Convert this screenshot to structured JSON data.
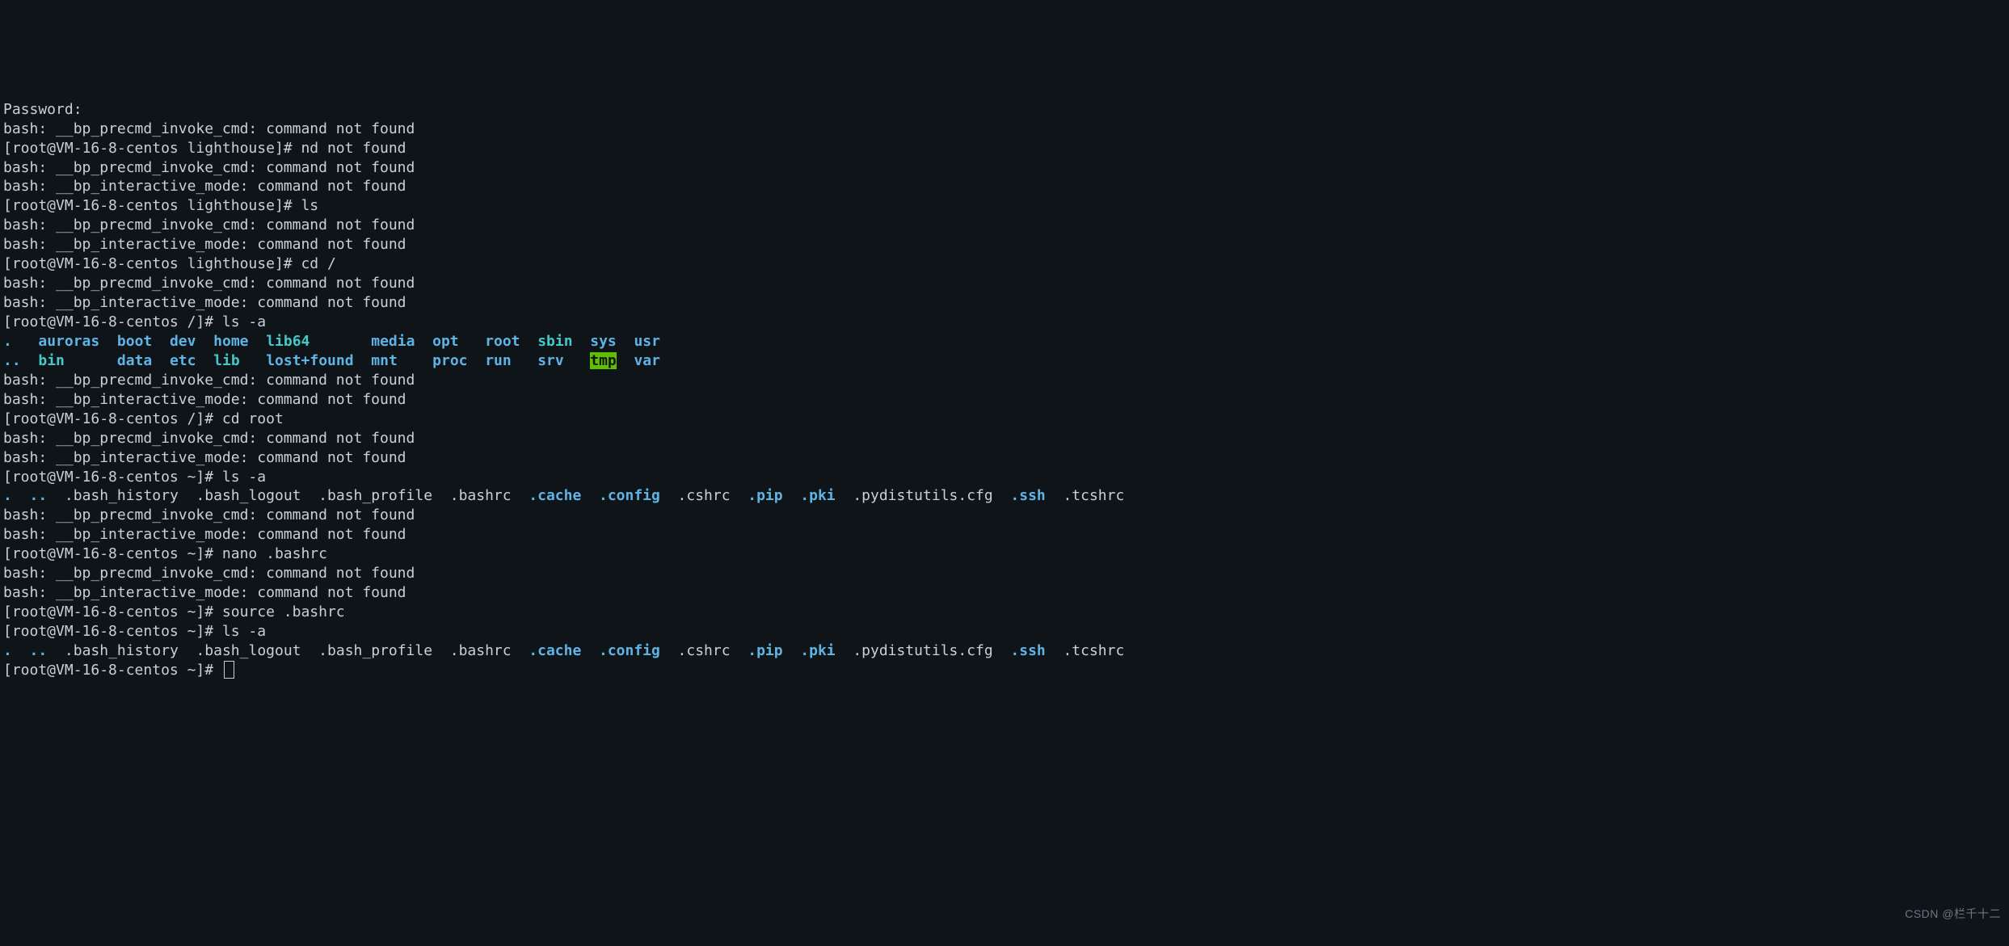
{
  "lines": [
    {
      "spans": [
        {
          "cls": "plain",
          "text": "Password:"
        }
      ]
    },
    {
      "spans": [
        {
          "cls": "plain",
          "text": "bash: __bp_precmd_invoke_cmd: command not found"
        }
      ]
    },
    {
      "spans": [
        {
          "cls": "plain",
          "text": "[root@VM-16-8-centos lighthouse]# nd not found"
        }
      ]
    },
    {
      "spans": [
        {
          "cls": "plain",
          "text": "bash: __bp_precmd_invoke_cmd: command not found"
        }
      ]
    },
    {
      "spans": [
        {
          "cls": "plain",
          "text": "bash: __bp_interactive_mode: command not found"
        }
      ]
    },
    {
      "spans": [
        {
          "cls": "plain",
          "text": "[root@VM-16-8-centos lighthouse]# ls"
        }
      ]
    },
    {
      "spans": [
        {
          "cls": "plain",
          "text": "bash: __bp_precmd_invoke_cmd: command not found"
        }
      ]
    },
    {
      "spans": [
        {
          "cls": "plain",
          "text": "bash: __bp_interactive_mode: command not found"
        }
      ]
    },
    {
      "spans": [
        {
          "cls": "plain",
          "text": "[root@VM-16-8-centos lighthouse]# cd /"
        }
      ]
    },
    {
      "spans": [
        {
          "cls": "plain",
          "text": "bash: __bp_precmd_invoke_cmd: command not found"
        }
      ]
    },
    {
      "spans": [
        {
          "cls": "plain",
          "text": "bash: __bp_interactive_mode: command not found"
        }
      ]
    },
    {
      "spans": [
        {
          "cls": "plain",
          "text": "[root@VM-16-8-centos /]# ls -a"
        }
      ]
    },
    {
      "spans": [
        {
          "cls": "dir",
          "text": "."
        },
        {
          "cls": "plain",
          "text": "   "
        },
        {
          "cls": "dir",
          "text": "auroras"
        },
        {
          "cls": "plain",
          "text": "  "
        },
        {
          "cls": "dir",
          "text": "boot"
        },
        {
          "cls": "plain",
          "text": "  "
        },
        {
          "cls": "dir",
          "text": "dev"
        },
        {
          "cls": "plain",
          "text": "  "
        },
        {
          "cls": "dir",
          "text": "home"
        },
        {
          "cls": "plain",
          "text": "  "
        },
        {
          "cls": "link",
          "text": "lib64"
        },
        {
          "cls": "plain",
          "text": "       "
        },
        {
          "cls": "dir",
          "text": "media"
        },
        {
          "cls": "plain",
          "text": "  "
        },
        {
          "cls": "dir",
          "text": "opt"
        },
        {
          "cls": "plain",
          "text": "   "
        },
        {
          "cls": "dir",
          "text": "root"
        },
        {
          "cls": "plain",
          "text": "  "
        },
        {
          "cls": "link",
          "text": "sbin"
        },
        {
          "cls": "plain",
          "text": "  "
        },
        {
          "cls": "dir",
          "text": "sys"
        },
        {
          "cls": "plain",
          "text": "  "
        },
        {
          "cls": "dir",
          "text": "usr"
        }
      ]
    },
    {
      "spans": [
        {
          "cls": "dir",
          "text": ".."
        },
        {
          "cls": "plain",
          "text": "  "
        },
        {
          "cls": "link",
          "text": "bin"
        },
        {
          "cls": "plain",
          "text": "      "
        },
        {
          "cls": "dir",
          "text": "data"
        },
        {
          "cls": "plain",
          "text": "  "
        },
        {
          "cls": "dir",
          "text": "etc"
        },
        {
          "cls": "plain",
          "text": "  "
        },
        {
          "cls": "link",
          "text": "lib"
        },
        {
          "cls": "plain",
          "text": "   "
        },
        {
          "cls": "dir",
          "text": "lost+found"
        },
        {
          "cls": "plain",
          "text": "  "
        },
        {
          "cls": "dir",
          "text": "mnt"
        },
        {
          "cls": "plain",
          "text": "    "
        },
        {
          "cls": "dir",
          "text": "proc"
        },
        {
          "cls": "plain",
          "text": "  "
        },
        {
          "cls": "dir",
          "text": "run"
        },
        {
          "cls": "plain",
          "text": "   "
        },
        {
          "cls": "dir",
          "text": "srv"
        },
        {
          "cls": "plain",
          "text": "   "
        },
        {
          "cls": "hl",
          "text": "tmp"
        },
        {
          "cls": "plain",
          "text": "  "
        },
        {
          "cls": "dir",
          "text": "var"
        }
      ]
    },
    {
      "spans": [
        {
          "cls": "plain",
          "text": "bash: __bp_precmd_invoke_cmd: command not found"
        }
      ]
    },
    {
      "spans": [
        {
          "cls": "plain",
          "text": "bash: __bp_interactive_mode: command not found"
        }
      ]
    },
    {
      "spans": [
        {
          "cls": "plain",
          "text": "[root@VM-16-8-centos /]# cd root"
        }
      ]
    },
    {
      "spans": [
        {
          "cls": "plain",
          "text": "bash: __bp_precmd_invoke_cmd: command not found"
        }
      ]
    },
    {
      "spans": [
        {
          "cls": "plain",
          "text": "bash: __bp_interactive_mode: command not found"
        }
      ]
    },
    {
      "spans": [
        {
          "cls": "plain",
          "text": "[root@VM-16-8-centos ~]# ls -a"
        }
      ]
    },
    {
      "spans": [
        {
          "cls": "dir",
          "text": "."
        },
        {
          "cls": "plain",
          "text": "  "
        },
        {
          "cls": "dir",
          "text": ".."
        },
        {
          "cls": "plain",
          "text": "  "
        },
        {
          "cls": "plain",
          "text": ".bash_history  .bash_logout  .bash_profile  .bashrc  "
        },
        {
          "cls": "dir",
          "text": ".cache"
        },
        {
          "cls": "plain",
          "text": "  "
        },
        {
          "cls": "dir",
          "text": ".config"
        },
        {
          "cls": "plain",
          "text": "  "
        },
        {
          "cls": "plain",
          "text": ".cshrc  "
        },
        {
          "cls": "dir",
          "text": ".pip"
        },
        {
          "cls": "plain",
          "text": "  "
        },
        {
          "cls": "dir",
          "text": ".pki"
        },
        {
          "cls": "plain",
          "text": "  "
        },
        {
          "cls": "plain",
          "text": ".pydistutils.cfg  "
        },
        {
          "cls": "dir",
          "text": ".ssh"
        },
        {
          "cls": "plain",
          "text": "  "
        },
        {
          "cls": "plain",
          "text": ".tcshrc"
        }
      ]
    },
    {
      "spans": [
        {
          "cls": "plain",
          "text": "bash: __bp_precmd_invoke_cmd: command not found"
        }
      ]
    },
    {
      "spans": [
        {
          "cls": "plain",
          "text": "bash: __bp_interactive_mode: command not found"
        }
      ]
    },
    {
      "spans": [
        {
          "cls": "plain",
          "text": "[root@VM-16-8-centos ~]# nano .bashrc"
        }
      ]
    },
    {
      "spans": [
        {
          "cls": "plain",
          "text": "bash: __bp_precmd_invoke_cmd: command not found"
        }
      ]
    },
    {
      "spans": [
        {
          "cls": "plain",
          "text": "bash: __bp_interactive_mode: command not found"
        }
      ]
    },
    {
      "spans": [
        {
          "cls": "plain",
          "text": "[root@VM-16-8-centos ~]# source .bashrc"
        }
      ]
    },
    {
      "spans": [
        {
          "cls": "plain",
          "text": "[root@VM-16-8-centos ~]# ls -a"
        }
      ]
    },
    {
      "spans": [
        {
          "cls": "dir",
          "text": "."
        },
        {
          "cls": "plain",
          "text": "  "
        },
        {
          "cls": "dir",
          "text": ".."
        },
        {
          "cls": "plain",
          "text": "  "
        },
        {
          "cls": "plain",
          "text": ".bash_history  .bash_logout  .bash_profile  .bashrc  "
        },
        {
          "cls": "dir",
          "text": ".cache"
        },
        {
          "cls": "plain",
          "text": "  "
        },
        {
          "cls": "dir",
          "text": ".config"
        },
        {
          "cls": "plain",
          "text": "  "
        },
        {
          "cls": "plain",
          "text": ".cshrc  "
        },
        {
          "cls": "dir",
          "text": ".pip"
        },
        {
          "cls": "plain",
          "text": "  "
        },
        {
          "cls": "dir",
          "text": ".pki"
        },
        {
          "cls": "plain",
          "text": "  "
        },
        {
          "cls": "plain",
          "text": ".pydistutils.cfg  "
        },
        {
          "cls": "dir",
          "text": ".ssh"
        },
        {
          "cls": "plain",
          "text": "  "
        },
        {
          "cls": "plain",
          "text": ".tcshrc"
        }
      ]
    },
    {
      "spans": [
        {
          "cls": "plain",
          "text": "[root@VM-16-8-centos ~]# "
        }
      ],
      "cursor": true
    }
  ],
  "watermark": "CSDN @栏千十二"
}
